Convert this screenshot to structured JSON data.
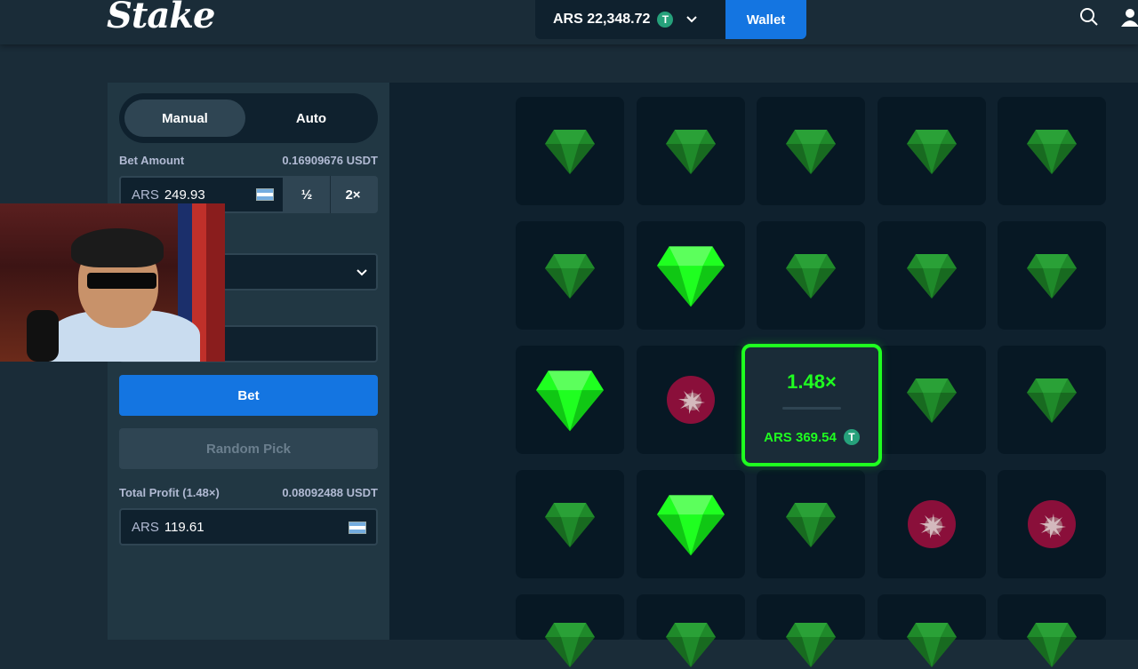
{
  "header": {
    "logo": "Stake",
    "balance": "ARS 22,348.72",
    "currency_icon": "T",
    "wallet_label": "Wallet"
  },
  "sidebar": {
    "tabs": [
      {
        "label": "Manual",
        "active": true
      },
      {
        "label": "Auto",
        "active": false
      }
    ],
    "bet_amount": {
      "label": "Bet Amount",
      "usdt_value": "0.16909676 USDT",
      "currency": "ARS",
      "value": "249.93",
      "half_label": "½",
      "double_label": "2×"
    },
    "bet_button": "Bet",
    "random_pick_button": "Random Pick",
    "total_profit": {
      "label": "Total Profit (1.48×)",
      "usdt_value": "0.08092488 USDT",
      "currency": "ARS",
      "value": "119.61"
    }
  },
  "board": {
    "win_popup": {
      "multiplier": "1.48×",
      "amount": "ARS 369.54",
      "currency_icon": "T"
    },
    "tiles": [
      [
        "gem",
        "gem",
        "gem",
        "gem",
        "gem"
      ],
      [
        "gem",
        "gem-revealed",
        "gem",
        "gem",
        "gem"
      ],
      [
        "gem-revealed",
        "mine",
        "popup",
        "gem",
        "gem"
      ],
      [
        "gem",
        "gem-revealed",
        "gem",
        "mine",
        "mine"
      ],
      [
        "gem",
        "gem",
        "gem",
        "gem",
        "gem"
      ]
    ]
  },
  "colors": {
    "background": "#1a2c38",
    "panel": "#213743",
    "accent_blue": "#1475e1",
    "win_green": "#1fff20",
    "mine_red": "#8a0f3a"
  }
}
